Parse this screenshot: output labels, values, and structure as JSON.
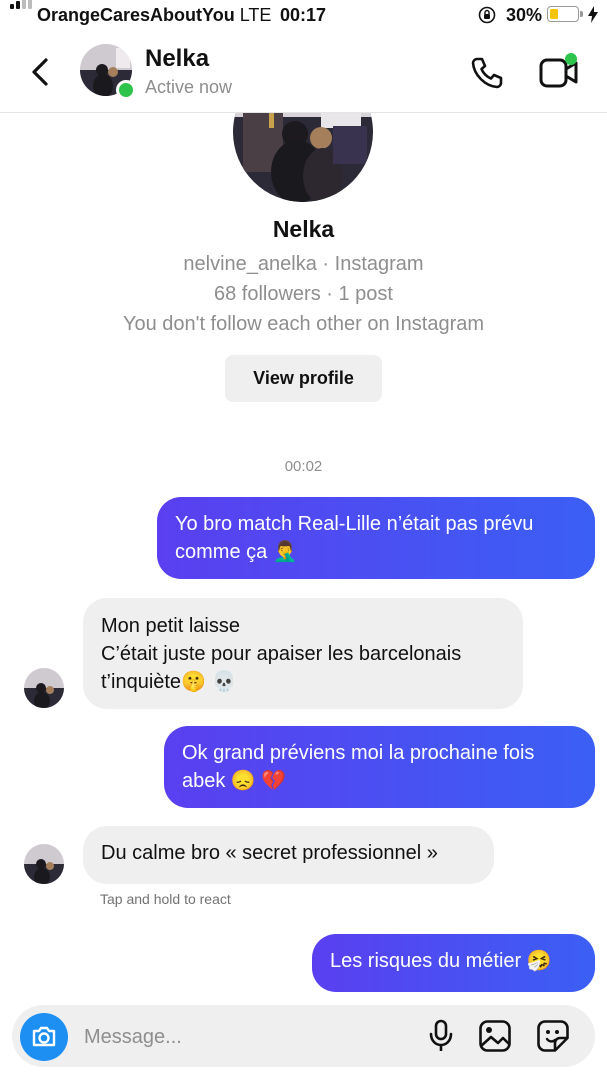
{
  "status_bar": {
    "carrier": "OrangeCaresAboutYou",
    "network": "LTE",
    "time": "00:17",
    "battery_percent_label": "30%",
    "battery_level": 0.3,
    "icons": [
      "signal-icon",
      "orientation-lock-icon",
      "battery-icon",
      "charging-bolt-icon"
    ]
  },
  "header": {
    "name": "Nelka",
    "status": "Active now",
    "icons": [
      "back-chevron-icon",
      "phone-icon",
      "video-call-icon"
    ]
  },
  "profile": {
    "name": "Nelka",
    "handle_line": "nelvine_anelka · Instagram",
    "stats_line": "68 followers · 1 post",
    "follow_line": "You don't follow each other on Instagram",
    "view_profile_label": "View profile"
  },
  "conversation": {
    "timestamp": "00:02",
    "messages": [
      {
        "from": "me",
        "text": "Yo bro match Real-Lille n’était pas prévu comme ça 🤦‍♂️"
      },
      {
        "from": "them",
        "lines": [
          "Mon petit laisse",
          "C’était juste pour apaiser les barcelonais",
          "t’inquiète🤫 💀"
        ]
      },
      {
        "from": "me",
        "text": "Ok grand préviens moi la prochaine fois abek 😞 💔"
      },
      {
        "from": "them",
        "text": "Du calme bro « secret professionnel »"
      },
      {
        "from": "me",
        "text": "Les risques du métier 🤧"
      }
    ],
    "react_hint": "Tap and hold to react"
  },
  "composer": {
    "placeholder": "Message...",
    "icons": [
      "camera-icon",
      "microphone-icon",
      "gallery-icon",
      "sticker-icon"
    ]
  },
  "colors": {
    "outgoing_bubble_start": "#5a3ff0",
    "outgoing_bubble_end": "#3b5ff5",
    "incoming_bubble": "#efefef",
    "online": "#2ec44b",
    "camera_button": "#1d8ff2",
    "battery_fill": "#f4c400"
  }
}
